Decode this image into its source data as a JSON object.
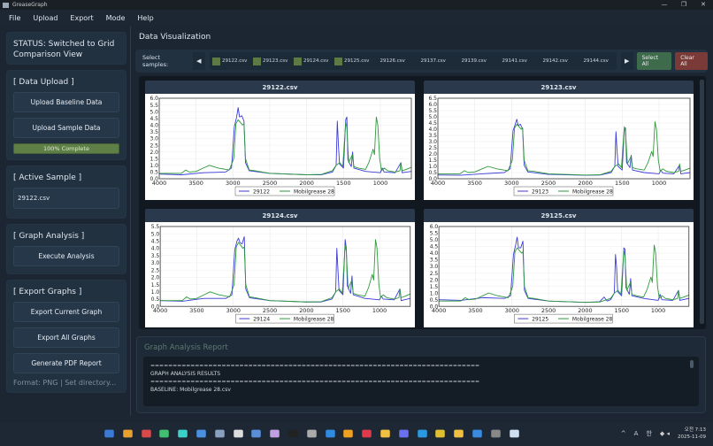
{
  "window": {
    "title": "GreaseGraph",
    "controls": [
      "—",
      "❐",
      "✕"
    ]
  },
  "menu": [
    "File",
    "Upload",
    "Export",
    "Mode",
    "Help"
  ],
  "left": {
    "status": "STATUS: Switched to Grid Comparison View",
    "data_upload": {
      "heading": "[ Data Upload ]",
      "upload_baseline": "Upload Baseline Data",
      "upload_sample": "Upload Sample Data",
      "progress_label": "100% Complete",
      "progress": 100
    },
    "active_sample": {
      "heading": "[ Active Sample ]",
      "value": "29122.csv"
    },
    "graph_analysis": {
      "heading": "[ Graph Analysis ]",
      "execute": "Execute Analysis"
    },
    "export": {
      "heading": "[ Export Graphs ]",
      "current": "Export Current Graph",
      "all": "Export All Graphs",
      "pdf": "Generate PDF Report",
      "hint": "Format: PNG | Set directory..."
    }
  },
  "main": {
    "title": "Data Visualization",
    "select_label": "Select samples:",
    "prev": "◀",
    "next": "▶",
    "samples": [
      {
        "name": "29122.csv",
        "selected": true
      },
      {
        "name": "29123.csv",
        "selected": true
      },
      {
        "name": "29124.csv",
        "selected": true
      },
      {
        "name": "29125.csv",
        "selected": true
      },
      {
        "name": "29126.csv",
        "selected": false
      },
      {
        "name": "29137.csv",
        "selected": false
      },
      {
        "name": "29139.csv",
        "selected": false
      },
      {
        "name": "29141.csv",
        "selected": false
      },
      {
        "name": "29142.csv",
        "selected": false
      },
      {
        "name": "29144.csv",
        "selected": false
      }
    ],
    "select_all": "Select All",
    "clear_all": "Clear All",
    "colors": {
      "selected": "#5e7a44",
      "select_all": "#3d6b4c",
      "clear_all": "#7a3a37",
      "sample_line": "#3b3bd8",
      "baseline_line": "#2e9a3a"
    }
  },
  "report": {
    "title": "Graph Analysis Report",
    "lines": [
      "==========================================================================",
      "GRAPH ANALYSIS RESULTS",
      "==========================================================================",
      "",
      "BASELINE: Mobilgrease 28.csv"
    ]
  },
  "taskbar": {
    "tray": [
      "^",
      "A",
      "한"
    ],
    "time": "오전 7:13",
    "date": "2025-11-09"
  },
  "chart_data": [
    {
      "type": "line",
      "title": "29122.csv",
      "xlim": [
        4000,
        580
      ],
      "ylim": [
        0,
        6.0
      ],
      "yticks": [
        0,
        0.5,
        1,
        1.5,
        2,
        2.5,
        3,
        3.5,
        4,
        4.5,
        5,
        5.5,
        6
      ],
      "xticks": [
        4000,
        3500,
        3000,
        2500,
        2000,
        1500,
        1000
      ],
      "legend": [
        "29122",
        "Mobilgrease 28"
      ],
      "series": [
        {
          "name": "29122",
          "points": [
            [
              4000,
              0.35
            ],
            [
              3700,
              0.3
            ],
            [
              3400,
              0.45
            ],
            [
              3100,
              0.5
            ],
            [
              3020,
              0.8
            ],
            [
              2980,
              3.9
            ],
            [
              2950,
              4.6
            ],
            [
              2930,
              5.3
            ],
            [
              2910,
              4.6
            ],
            [
              2880,
              4.7
            ],
            [
              2850,
              4.3
            ],
            [
              2830,
              1.2
            ],
            [
              2780,
              0.6
            ],
            [
              2500,
              0.4
            ],
            [
              2000,
              0.3
            ],
            [
              1800,
              0.3
            ],
            [
              1650,
              0.5
            ],
            [
              1600,
              1.0
            ],
            [
              1585,
              4.3
            ],
            [
              1570,
              2.6
            ],
            [
              1555,
              1.1
            ],
            [
              1500,
              0.8
            ],
            [
              1470,
              4.4
            ],
            [
              1455,
              4.6
            ],
            [
              1440,
              1.4
            ],
            [
              1395,
              0.9
            ],
            [
              1377,
              2.0
            ],
            [
              1360,
              0.8
            ],
            [
              1200,
              0.55
            ],
            [
              1000,
              0.45
            ],
            [
              975,
              0.8
            ],
            [
              950,
              0.5
            ],
            [
              800,
              0.45
            ],
            [
              722,
              1.2
            ],
            [
              705,
              0.45
            ],
            [
              580,
              0.55
            ]
          ]
        },
        {
          "name": "Mobilgrease 28",
          "points": [
            [
              4000,
              0.4
            ],
            [
              3700,
              0.4
            ],
            [
              3640,
              0.65
            ],
            [
              3590,
              0.5
            ],
            [
              3500,
              0.55
            ],
            [
              3400,
              0.8
            ],
            [
              3320,
              1.0
            ],
            [
              3200,
              0.8
            ],
            [
              3050,
              0.65
            ],
            [
              2990,
              1.5
            ],
            [
              2960,
              4.1
            ],
            [
              2930,
              4.4
            ],
            [
              2900,
              4.2
            ],
            [
              2870,
              4.0
            ],
            [
              2850,
              4.1
            ],
            [
              2830,
              1.5
            ],
            [
              2780,
              0.65
            ],
            [
              2700,
              0.6
            ],
            [
              2500,
              0.4
            ],
            [
              2000,
              0.3
            ],
            [
              1800,
              0.32
            ],
            [
              1650,
              0.6
            ],
            [
              1600,
              1.0
            ],
            [
              1550,
              1.2
            ],
            [
              1510,
              0.9
            ],
            [
              1470,
              4.2
            ],
            [
              1455,
              3.8
            ],
            [
              1430,
              1.2
            ],
            [
              1380,
              1.8
            ],
            [
              1360,
              0.9
            ],
            [
              1300,
              0.8
            ],
            [
              1200,
              0.7
            ],
            [
              1150,
              1.3
            ],
            [
              1100,
              2.2
            ],
            [
              1080,
              1.8
            ],
            [
              1055,
              4.6
            ],
            [
              1035,
              4.0
            ],
            [
              1010,
              1.5
            ],
            [
              985,
              0.6
            ],
            [
              950,
              0.8
            ],
            [
              900,
              0.6
            ],
            [
              800,
              0.5
            ],
            [
              735,
              0.6
            ],
            [
              722,
              1.2
            ],
            [
              705,
              0.6
            ],
            [
              650,
              0.7
            ],
            [
              580,
              0.85
            ]
          ]
        }
      ]
    },
    {
      "type": "line",
      "title": "29123.csv",
      "xlim": [
        4000,
        580
      ],
      "ylim": [
        0,
        6.5
      ],
      "yticks": [
        0,
        0.5,
        1,
        1.5,
        2,
        2.5,
        3,
        3.5,
        4,
        4.5,
        5,
        5.5,
        6,
        6.5
      ],
      "xticks": [
        4000,
        3500,
        3000,
        2500,
        2000,
        1500,
        1000
      ],
      "legend": [
        "29123",
        "Mobilgrease 28"
      ],
      "series": [
        {
          "name": "29123",
          "points": [
            [
              4000,
              0.3
            ],
            [
              3700,
              0.28
            ],
            [
              3400,
              0.4
            ],
            [
              3100,
              0.5
            ],
            [
              3020,
              0.8
            ],
            [
              2980,
              3.9
            ],
            [
              2950,
              4.4
            ],
            [
              2930,
              4.8
            ],
            [
              2910,
              4.3
            ],
            [
              2880,
              4.4
            ],
            [
              2850,
              4.0
            ],
            [
              2830,
              1.1
            ],
            [
              2780,
              0.55
            ],
            [
              2500,
              0.35
            ],
            [
              2000,
              0.28
            ],
            [
              1800,
              0.3
            ],
            [
              1650,
              0.5
            ],
            [
              1600,
              1.0
            ],
            [
              1585,
              3.8
            ],
            [
              1570,
              2.3
            ],
            [
              1555,
              1.0
            ],
            [
              1500,
              0.7
            ],
            [
              1470,
              4.0
            ],
            [
              1455,
              4.1
            ],
            [
              1440,
              1.3
            ],
            [
              1395,
              0.9
            ],
            [
              1377,
              1.9
            ],
            [
              1360,
              0.7
            ],
            [
              1200,
              0.5
            ],
            [
              1000,
              0.4
            ],
            [
              975,
              0.7
            ],
            [
              950,
              0.45
            ],
            [
              800,
              0.4
            ],
            [
              722,
              1.1
            ],
            [
              705,
              0.4
            ],
            [
              580,
              0.5
            ]
          ]
        },
        {
          "name": "Mobilgrease 28",
          "ref": 0
        }
      ]
    },
    {
      "type": "line",
      "title": "29124.csv",
      "xlim": [
        4000,
        580
      ],
      "ylim": [
        0,
        5.5
      ],
      "yticks": [
        0,
        0.5,
        1,
        1.5,
        2,
        2.5,
        3,
        3.5,
        4,
        4.5,
        5,
        5.5
      ],
      "xticks": [
        4000,
        3500,
        3000,
        2500,
        2000,
        1500,
        1000
      ],
      "legend": [
        "29124",
        "Mobilgrease 28"
      ],
      "series": [
        {
          "name": "29124",
          "points": [
            [
              4000,
              0.4
            ],
            [
              3700,
              0.35
            ],
            [
              3400,
              0.55
            ],
            [
              3100,
              0.55
            ],
            [
              3020,
              0.8
            ],
            [
              2980,
              3.9
            ],
            [
              2950,
              4.5
            ],
            [
              2930,
              4.7
            ],
            [
              2910,
              4.4
            ],
            [
              2880,
              4.3
            ],
            [
              2850,
              4.8
            ],
            [
              2830,
              1.2
            ],
            [
              2780,
              0.6
            ],
            [
              2500,
              0.4
            ],
            [
              2000,
              0.3
            ],
            [
              1800,
              0.3
            ],
            [
              1650,
              0.5
            ],
            [
              1600,
              1.0
            ],
            [
              1585,
              4.0
            ],
            [
              1570,
              2.6
            ],
            [
              1555,
              1.1
            ],
            [
              1500,
              0.8
            ],
            [
              1470,
              4.6
            ],
            [
              1455,
              4.0
            ],
            [
              1440,
              1.4
            ],
            [
              1395,
              0.9
            ],
            [
              1377,
              2.1
            ],
            [
              1360,
              0.8
            ],
            [
              1200,
              0.55
            ],
            [
              1000,
              0.45
            ],
            [
              975,
              0.7
            ],
            [
              950,
              0.5
            ],
            [
              800,
              0.45
            ],
            [
              722,
              1.2
            ],
            [
              705,
              0.4
            ],
            [
              580,
              0.55
            ]
          ]
        },
        {
          "name": "Mobilgrease 28",
          "ref": 0
        }
      ]
    },
    {
      "type": "line",
      "title": "29125.csv",
      "xlim": [
        4000,
        580
      ],
      "ylim": [
        0,
        6.0
      ],
      "yticks": [
        0,
        0.5,
        1,
        1.5,
        2,
        2.5,
        3,
        3.5,
        4,
        4.5,
        5,
        5.5,
        6
      ],
      "xticks": [
        4000,
        3500,
        3000,
        2500,
        2000,
        1500,
        1000
      ],
      "legend": [
        "29125",
        "Mobilgrease 28"
      ],
      "series": [
        {
          "name": "29125",
          "points": [
            [
              4000,
              0.5
            ],
            [
              3700,
              0.45
            ],
            [
              3400,
              0.65
            ],
            [
              3100,
              0.6
            ],
            [
              3020,
              0.8
            ],
            [
              2980,
              3.9
            ],
            [
              2950,
              4.6
            ],
            [
              2930,
              5.2
            ],
            [
              2910,
              4.4
            ],
            [
              2880,
              4.4
            ],
            [
              2850,
              4.9
            ],
            [
              2830,
              1.2
            ],
            [
              2780,
              0.6
            ],
            [
              2500,
              0.4
            ],
            [
              2000,
              0.3
            ],
            [
              1800,
              0.35
            ],
            [
              1740,
              0.7
            ],
            [
              1700,
              0.4
            ],
            [
              1650,
              0.5
            ],
            [
              1600,
              1.0
            ],
            [
              1585,
              3.9
            ],
            [
              1570,
              3.0
            ],
            [
              1555,
              1.1
            ],
            [
              1500,
              0.8
            ],
            [
              1470,
              4.4
            ],
            [
              1455,
              4.3
            ],
            [
              1440,
              1.4
            ],
            [
              1395,
              0.9
            ],
            [
              1377,
              2.1
            ],
            [
              1360,
              0.8
            ],
            [
              1200,
              0.6
            ],
            [
              1000,
              0.45
            ],
            [
              975,
              0.9
            ],
            [
              950,
              0.5
            ],
            [
              800,
              0.45
            ],
            [
              722,
              1.2
            ],
            [
              705,
              0.45
            ],
            [
              580,
              0.6
            ]
          ]
        },
        {
          "name": "Mobilgrease 28",
          "ref": 0
        }
      ]
    }
  ]
}
